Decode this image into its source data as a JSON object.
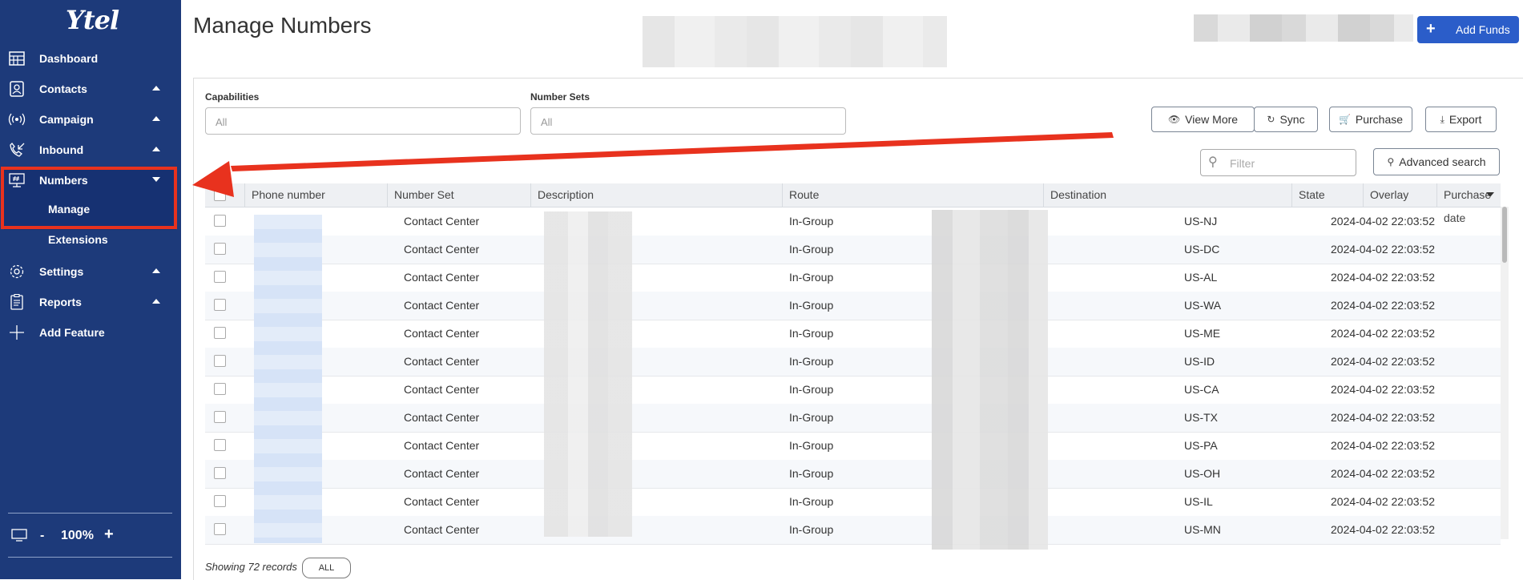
{
  "sidebar": {
    "logo": "Ytel",
    "items": [
      {
        "label": "Dashboard",
        "icon": "dashboard-icon"
      },
      {
        "label": "Contacts",
        "icon": "contacts-icon"
      },
      {
        "label": "Campaign",
        "icon": "broadcast-icon"
      },
      {
        "label": "Inbound",
        "icon": "phone-incoming-icon"
      },
      {
        "label": "Numbers",
        "icon": "numbers-icon"
      },
      {
        "label": "Settings",
        "icon": "gear-icon"
      },
      {
        "label": "Reports",
        "icon": "clipboard-icon"
      },
      {
        "label": "Add Feature",
        "icon": "plus-icon"
      }
    ],
    "submenu": [
      "Manage",
      "Extensions"
    ],
    "zoom": {
      "minus": "-",
      "value": "100%",
      "plus": "+"
    }
  },
  "page": {
    "title": "Manage Numbers"
  },
  "header": {
    "add_funds_label": "Add Funds",
    "add_funds_icon": "+"
  },
  "filters": {
    "capabilities_label": "Capabilities",
    "capabilities_value": "All",
    "number_sets_label": "Number Sets",
    "number_sets_value": "All",
    "filter_placeholder": "Filter"
  },
  "toolbar": {
    "view_more": "View More",
    "sync": "Sync",
    "purchase": "Purchase",
    "export": "Export",
    "advanced_search": "Advanced search"
  },
  "table": {
    "columns": [
      "Phone number",
      "Number Set",
      "Description",
      "Route",
      "Destination",
      "State",
      "Overlay",
      "Purchase date"
    ],
    "rows": [
      {
        "number_set": "Contact Center",
        "route": "In-Group",
        "state": "US-NJ",
        "purchase_date": "2024-04-02 22:03:52"
      },
      {
        "number_set": "Contact Center",
        "route": "In-Group",
        "state": "US-DC",
        "purchase_date": "2024-04-02 22:03:52"
      },
      {
        "number_set": "Contact Center",
        "route": "In-Group",
        "state": "US-AL",
        "purchase_date": "2024-04-02 22:03:52"
      },
      {
        "number_set": "Contact Center",
        "route": "In-Group",
        "state": "US-WA",
        "purchase_date": "2024-04-02 22:03:52"
      },
      {
        "number_set": "Contact Center",
        "route": "In-Group",
        "state": "US-ME",
        "purchase_date": "2024-04-02 22:03:52"
      },
      {
        "number_set": "Contact Center",
        "route": "In-Group",
        "state": "US-ID",
        "purchase_date": "2024-04-02 22:03:52"
      },
      {
        "number_set": "Contact Center",
        "route": "In-Group",
        "state": "US-CA",
        "purchase_date": "2024-04-02 22:03:52"
      },
      {
        "number_set": "Contact Center",
        "route": "In-Group",
        "state": "US-TX",
        "purchase_date": "2024-04-02 22:03:52"
      },
      {
        "number_set": "Contact Center",
        "route": "In-Group",
        "state": "US-PA",
        "purchase_date": "2024-04-02 22:03:52"
      },
      {
        "number_set": "Contact Center",
        "route": "In-Group",
        "state": "US-OH",
        "purchase_date": "2024-04-02 22:03:52"
      },
      {
        "number_set": "Contact Center",
        "route": "In-Group",
        "state": "US-IL",
        "purchase_date": "2024-04-02 22:03:52"
      },
      {
        "number_set": "Contact Center",
        "route": "In-Group",
        "state": "US-MN",
        "purchase_date": "2024-04-02 22:03:52"
      }
    ]
  },
  "footer": {
    "records_text": "Showing 72 records",
    "page_size": "ALL"
  },
  "colors": {
    "sidebar": "#1d3a7a",
    "accent": "#2b5dc9",
    "annotation": "#e8321e"
  }
}
